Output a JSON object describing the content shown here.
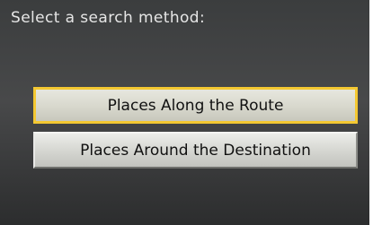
{
  "screen": {
    "title": "Select a search method:"
  },
  "options": [
    {
      "label": "Places Along the Route",
      "selected": true
    },
    {
      "label": "Places Around the Destination",
      "selected": false
    }
  ],
  "colors": {
    "background": "#3b3d3e",
    "button_face": "#d4d5d0",
    "selection_highlight": "#f4c832",
    "title_text": "#e6e6e6",
    "button_text": "#111111"
  }
}
